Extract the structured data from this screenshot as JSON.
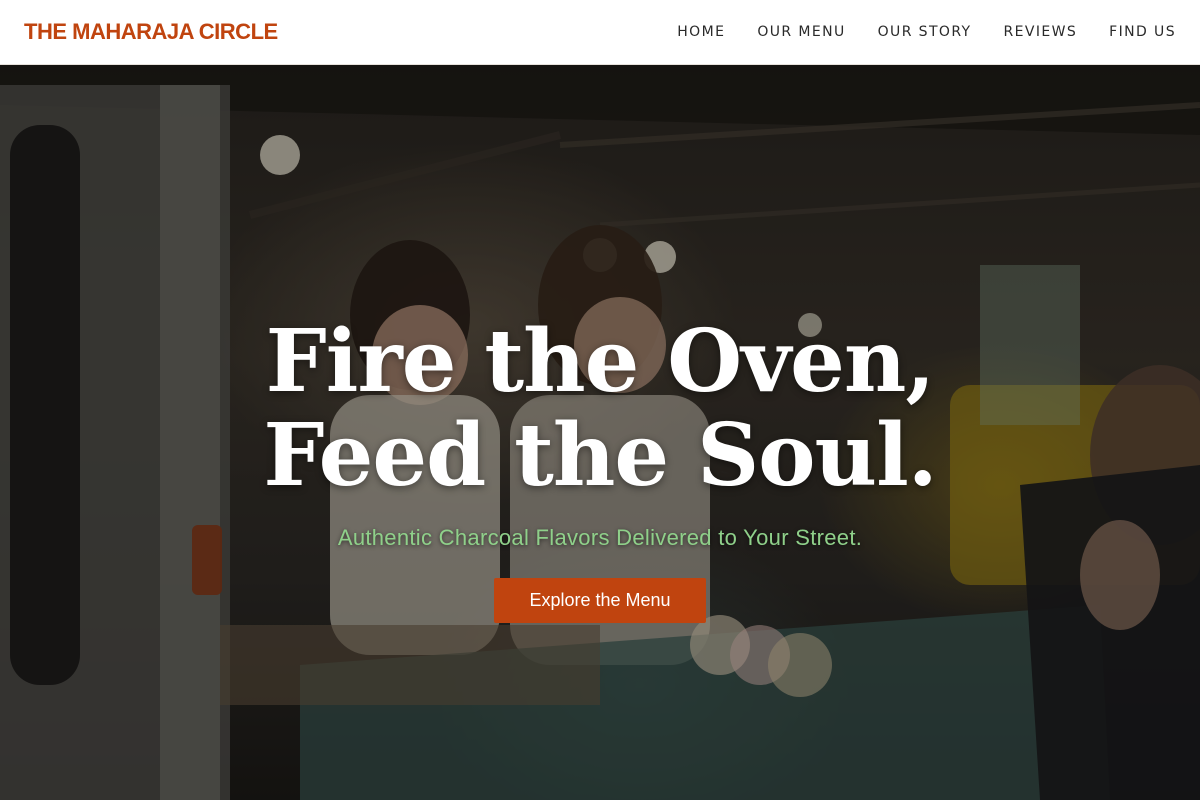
{
  "header": {
    "brand": "THE MAHARAJA CIRCLE",
    "nav": [
      {
        "label": "HOME"
      },
      {
        "label": "OUR MENU"
      },
      {
        "label": "OUR STORY"
      },
      {
        "label": "REVIEWS"
      },
      {
        "label": "FIND US"
      }
    ]
  },
  "hero": {
    "headline_line1": "Fire the Oven,",
    "headline_line2": "Feed the Soul.",
    "subtitle": "Authentic Charcoal Flavors Delivered to Your Street.",
    "cta_label": "Explore the Menu"
  },
  "colors": {
    "accent": "#c0440f",
    "subtitle": "#8fd08a",
    "nav_text": "#2a2a2a"
  }
}
